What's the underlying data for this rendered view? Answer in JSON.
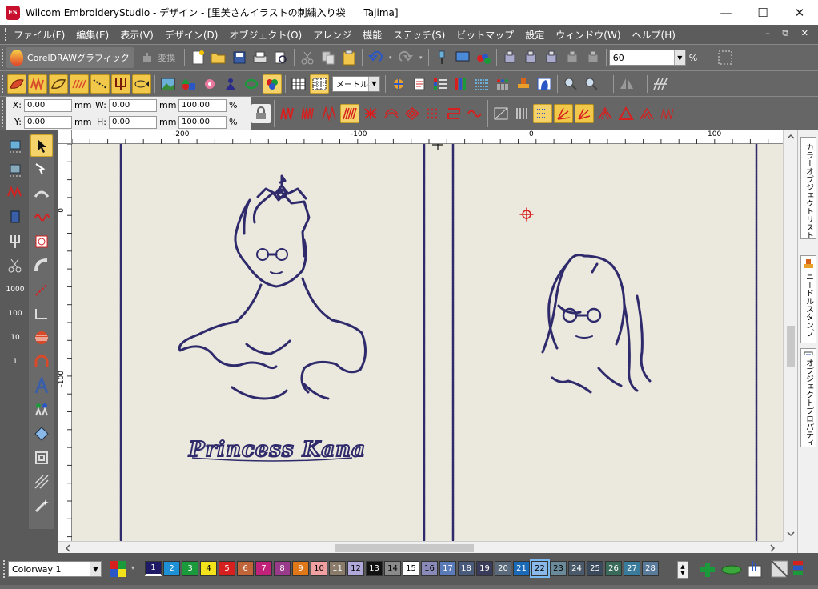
{
  "window": {
    "title": "Wilcom EmbroideryStudio - デザイン - [里美さんイラストの刺繍入り袋      Tajima]",
    "app_icon": "ES",
    "min_icon": "—",
    "max_icon": "☐",
    "close_icon": "✕"
  },
  "menu": {
    "items": [
      "ファイル(F)",
      "編集(E)",
      "表示(V)",
      "デザイン(D)",
      "オブジェクト(O)",
      "アレンジ",
      "機能",
      "ステッチ(S)",
      "ビットマップ",
      "設定",
      "ウィンドウ(W)",
      "ヘルプ(H)"
    ],
    "mdi_controls": "– ⧉ ✕"
  },
  "toolbar1": {
    "corel_label": "CorelDRAWグラフィック",
    "convert_label": "変換",
    "zoom_value": "60",
    "zoom_unit": "%"
  },
  "toolbar2": {
    "measure_value": "メートル法"
  },
  "props": {
    "x_label": "X:",
    "x_value": "0.00",
    "x_unit": "mm",
    "y_label": "Y:",
    "y_value": "0.00",
    "y_unit": "mm",
    "w_label": "W:",
    "w_value": "0.00",
    "w_unit": "mm",
    "h_label": "H:",
    "h_value": "0.00",
    "h_unit": "mm",
    "sx_value": "100.00",
    "sx_unit": "%",
    "sy_value": "100.00",
    "sy_unit": "%"
  },
  "ruler": {
    "h_labels": [
      "-200",
      "-100",
      "0",
      "100"
    ],
    "v_labels": [
      "0",
      "-100"
    ]
  },
  "canvas": {
    "embroidery_text": "Princess Kana",
    "thread_color": "#2e2a6b",
    "background": "#ebe8dd"
  },
  "docker": {
    "tab1": "カラーオブジェクトリスト",
    "tab2": "ニードルスタンプ",
    "tab3": "オブジェクトプロパティ"
  },
  "status": {
    "colorway": "Colorway 1",
    "swatches": [
      {
        "n": "1",
        "color": "#1f1a66",
        "text": "#fff"
      },
      {
        "n": "2",
        "color": "#1e90d6",
        "text": "#fff"
      },
      {
        "n": "3",
        "color": "#1a9a3a",
        "text": "#fff"
      },
      {
        "n": "4",
        "color": "#f4e21a",
        "text": "#000"
      },
      {
        "n": "5",
        "color": "#d62020",
        "text": "#fff"
      },
      {
        "n": "6",
        "color": "#c0643a",
        "text": "#fff"
      },
      {
        "n": "7",
        "color": "#c0227a",
        "text": "#fff"
      },
      {
        "n": "8",
        "color": "#9a3a8a",
        "text": "#fff"
      },
      {
        "n": "9",
        "color": "#e0781a",
        "text": "#fff"
      },
      {
        "n": "10",
        "color": "#f0a0a0",
        "text": "#000"
      },
      {
        "n": "11",
        "color": "#8a7a6a",
        "text": "#fff"
      },
      {
        "n": "12",
        "color": "#b0a8d8",
        "text": "#000"
      },
      {
        "n": "13",
        "color": "#111111",
        "text": "#fff"
      },
      {
        "n": "14",
        "color": "#8a8a8a",
        "text": "#000"
      },
      {
        "n": "15",
        "color": "#ffffff",
        "text": "#000"
      },
      {
        "n": "16",
        "color": "#8a8ab8",
        "text": "#000"
      },
      {
        "n": "17",
        "color": "#5a7ab8",
        "text": "#fff"
      },
      {
        "n": "18",
        "color": "#4a5a7a",
        "text": "#fff"
      },
      {
        "n": "19",
        "color": "#3a3a5a",
        "text": "#fff"
      },
      {
        "n": "20",
        "color": "#5a6a7a",
        "text": "#fff"
      },
      {
        "n": "21",
        "color": "#1a6ab8",
        "text": "#fff"
      },
      {
        "n": "22",
        "color": "#8ab8e8",
        "text": "#000"
      },
      {
        "n": "23",
        "color": "#6a8a9a",
        "text": "#000"
      },
      {
        "n": "24",
        "color": "#4a5a6a",
        "text": "#fff"
      },
      {
        "n": "25",
        "color": "#3a4a5a",
        "text": "#fff"
      },
      {
        "n": "26",
        "color": "#3a6a5a",
        "text": "#fff"
      },
      {
        "n": "27",
        "color": "#3a7a9a",
        "text": "#fff"
      },
      {
        "n": "28",
        "color": "#5a7a9a",
        "text": "#fff"
      }
    ],
    "selected_swatch": "22"
  }
}
